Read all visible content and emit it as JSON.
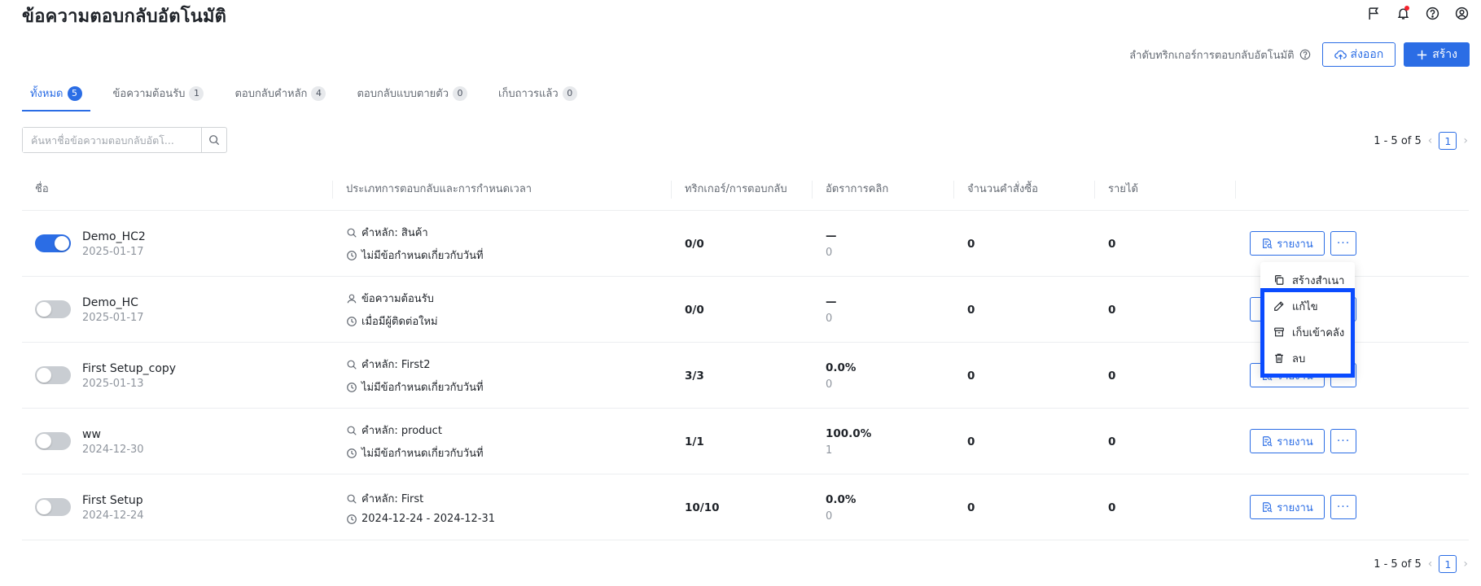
{
  "header": {
    "title": "ข้อความตอบกลับอัตโนมัติ",
    "icons": [
      "flag-icon",
      "bell-icon",
      "help-icon",
      "user-icon"
    ]
  },
  "actions": {
    "order_link": "ลำดับทริกเกอร์การตอบกลับอัตโนมัติ",
    "export_label": "ส่งออก",
    "create_label": "สร้าง"
  },
  "tabs": [
    {
      "label": "ทั้งหมด",
      "count": "5",
      "active": true
    },
    {
      "label": "ข้อความต้อนรับ",
      "count": "1",
      "active": false
    },
    {
      "label": "ตอบกลับคำหลัก",
      "count": "4",
      "active": false
    },
    {
      "label": "ตอบกลับแบบตายตัว",
      "count": "0",
      "active": false
    },
    {
      "label": "เก็บถาวรแล้ว",
      "count": "0",
      "active": false
    }
  ],
  "search": {
    "placeholder": "ค้นหาชื่อข้อความตอบกลับอัตโ...",
    "value": ""
  },
  "pagination": {
    "range_text": "1 - 5 of 5",
    "current_page": "1",
    "prev": "‹",
    "next": "›"
  },
  "table": {
    "columns": [
      "ชื่อ",
      "ประเภทการตอบกลับและการกำหนดเวลา",
      "ทริกเกอร์/การตอบกลับ",
      "อัตราการคลิก",
      "จำนวนคำสั่งซื้อ",
      "รายได้"
    ],
    "report_label": "รายงาน",
    "more_label": "···",
    "rows": [
      {
        "enabled": true,
        "name": "Demo_HC2",
        "date": "2025-01-17",
        "type_icon": "search-icon",
        "type_text": "คำหลัก: สินค้า",
        "schedule": "ไม่มีข้อกำหนดเกี่ยวกับวันที่",
        "triggers": "0/0",
        "ctr": "—",
        "ctr_sub": "0",
        "orders": "0",
        "revenue": "0"
      },
      {
        "enabled": false,
        "name": "Demo_HC",
        "date": "2025-01-17",
        "type_icon": "user-icon",
        "type_text": "ข้อความต้อนรับ",
        "schedule": "เมื่อมีผู้ติดต่อใหม่",
        "triggers": "0/0",
        "ctr": "—",
        "ctr_sub": "0",
        "orders": "0",
        "revenue": "0"
      },
      {
        "enabled": false,
        "name": "First Setup_copy",
        "date": "2025-01-13",
        "type_icon": "search-icon",
        "type_text": "คำหลัก: First2",
        "schedule": "ไม่มีข้อกำหนดเกี่ยวกับวันที่",
        "triggers": "3/3",
        "ctr": "0.0%",
        "ctr_sub": "0",
        "orders": "0",
        "revenue": "0"
      },
      {
        "enabled": false,
        "name": "ww",
        "date": "2024-12-30",
        "type_icon": "search-icon",
        "type_text": "คำหลัก: product",
        "schedule": "ไม่มีข้อกำหนดเกี่ยวกับวันที่",
        "triggers": "1/1",
        "ctr": "100.0%",
        "ctr_sub": "1",
        "orders": "0",
        "revenue": "0"
      },
      {
        "enabled": false,
        "name": "First Setup",
        "date": "2024-12-24",
        "type_icon": "search-icon",
        "type_text": "คำหลัก: First",
        "schedule": "2024-12-24 - 2024-12-31",
        "triggers": "10/10",
        "ctr": "0.0%",
        "ctr_sub": "0",
        "orders": "0",
        "revenue": "0"
      }
    ]
  },
  "dropdown": {
    "items": [
      {
        "label": "สร้างสำเนา",
        "icon": "copy-icon"
      },
      {
        "label": "แก้ไข",
        "icon": "edit-icon"
      },
      {
        "label": "เก็บเข้าคลัง",
        "icon": "archive-icon"
      },
      {
        "label": "ลบ",
        "icon": "trash-icon"
      }
    ]
  },
  "colors": {
    "accent": "#2b6de5",
    "highlight": "#0a4bff"
  }
}
